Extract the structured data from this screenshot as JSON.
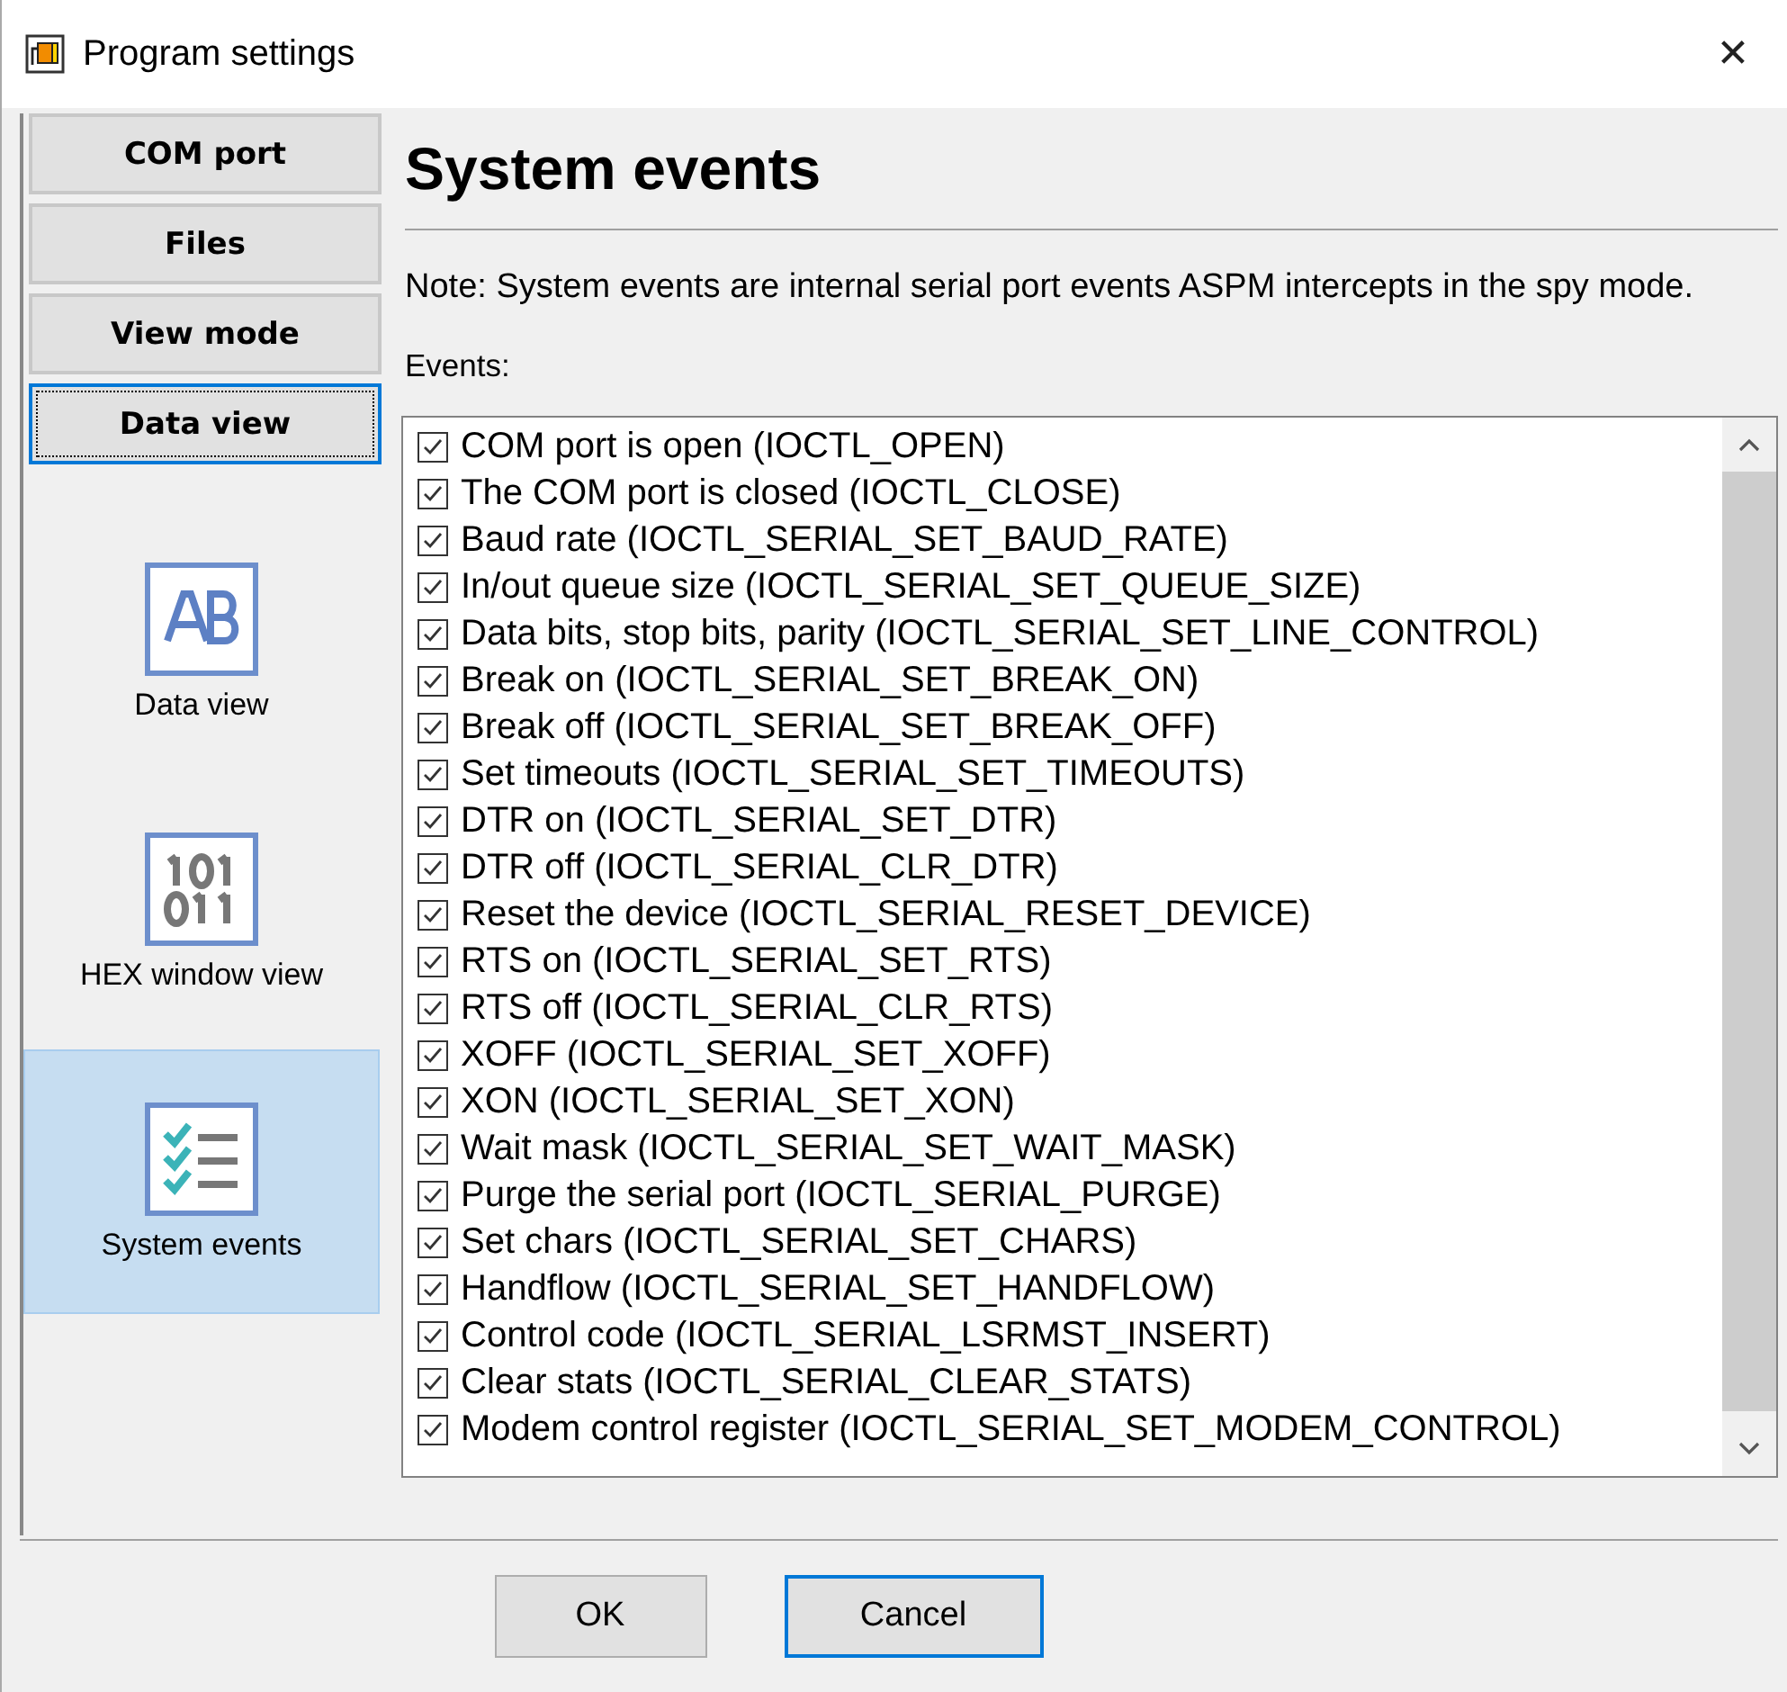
{
  "window": {
    "title": "Program settings",
    "close": "✕"
  },
  "sidebar": {
    "buttons": [
      {
        "label": "COM port",
        "focused": false
      },
      {
        "label": "Files",
        "focused": false
      },
      {
        "label": "View mode",
        "focused": false
      },
      {
        "label": "Data view",
        "focused": true
      }
    ],
    "views": [
      {
        "label": "Data view",
        "kind": "ab",
        "selected": false
      },
      {
        "label": "HEX window view",
        "kind": "binary",
        "selected": false
      },
      {
        "label": "System events",
        "kind": "checklist",
        "selected": true
      }
    ]
  },
  "heading": "System events",
  "note": "Note: System events are internal serial port events ASPM intercepts in the spy mode.",
  "events_label": "Events:",
  "events": [
    {
      "label": "COM port is open (IOCTL_OPEN)",
      "checked": true
    },
    {
      "label": "The COM port is closed (IOCTL_CLOSE)",
      "checked": true
    },
    {
      "label": "Baud rate (IOCTL_SERIAL_SET_BAUD_RATE)",
      "checked": true
    },
    {
      "label": "In/out queue size (IOCTL_SERIAL_SET_QUEUE_SIZE)",
      "checked": true
    },
    {
      "label": "Data bits, stop bits, parity (IOCTL_SERIAL_SET_LINE_CONTROL)",
      "checked": true
    },
    {
      "label": "Break on (IOCTL_SERIAL_SET_BREAK_ON)",
      "checked": true
    },
    {
      "label": "Break off (IOCTL_SERIAL_SET_BREAK_OFF)",
      "checked": true
    },
    {
      "label": "Set timeouts (IOCTL_SERIAL_SET_TIMEOUTS)",
      "checked": true
    },
    {
      "label": "DTR on (IOCTL_SERIAL_SET_DTR)",
      "checked": true
    },
    {
      "label": "DTR off (IOCTL_SERIAL_CLR_DTR)",
      "checked": true
    },
    {
      "label": "Reset the device (IOCTL_SERIAL_RESET_DEVICE)",
      "checked": true
    },
    {
      "label": "RTS on (IOCTL_SERIAL_SET_RTS)",
      "checked": true
    },
    {
      "label": "RTS off (IOCTL_SERIAL_CLR_RTS)",
      "checked": true
    },
    {
      "label": "XOFF (IOCTL_SERIAL_SET_XOFF)",
      "checked": true
    },
    {
      "label": "XON (IOCTL_SERIAL_SET_XON)",
      "checked": true
    },
    {
      "label": "Wait mask (IOCTL_SERIAL_SET_WAIT_MASK)",
      "checked": true
    },
    {
      "label": "Purge the serial port (IOCTL_SERIAL_PURGE)",
      "checked": true
    },
    {
      "label": "Set chars (IOCTL_SERIAL_SET_CHARS)",
      "checked": true
    },
    {
      "label": "Handflow (IOCTL_SERIAL_SET_HANDFLOW)",
      "checked": true
    },
    {
      "label": "Control code (IOCTL_SERIAL_LSRMST_INSERT)",
      "checked": true
    },
    {
      "label": "Clear stats (IOCTL_SERIAL_CLEAR_STATS)",
      "checked": true
    },
    {
      "label": "Modem control register (IOCTL_SERIAL_SET_MODEM_CONTROL)",
      "checked": true
    }
  ],
  "buttons": [
    {
      "label": "OK",
      "default": false
    },
    {
      "label": "Cancel",
      "default": true
    }
  ]
}
